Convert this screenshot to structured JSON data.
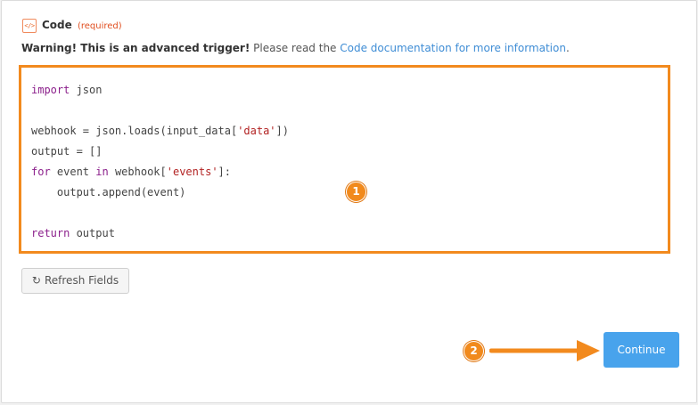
{
  "field": {
    "icon": "code-icon",
    "icon_glyph": "</>",
    "label": "Code",
    "required_text": "(required)"
  },
  "warning": {
    "bold_text": "Warning! This is an advanced trigger!",
    "text": " Please read the ",
    "link_text": "Code documentation for more information",
    "end_text": "."
  },
  "code_lines": [
    "import json",
    "",
    "webhook = json.loads(input_data['data'])",
    "output = []",
    "for event in webhook['events']:",
    "    output.append(event)",
    "",
    "return output"
  ],
  "annotations": {
    "badge_1": "1",
    "badge_2": "2"
  },
  "buttons": {
    "refresh_icon": "refresh-icon",
    "refresh_label": "Refresh Fields",
    "continue_label": "Continue"
  },
  "colors": {
    "highlight_orange": "#f28a1e",
    "continue_blue": "#48a3ec",
    "link_blue": "#3f8dd5",
    "required_red": "#e04e1f"
  }
}
